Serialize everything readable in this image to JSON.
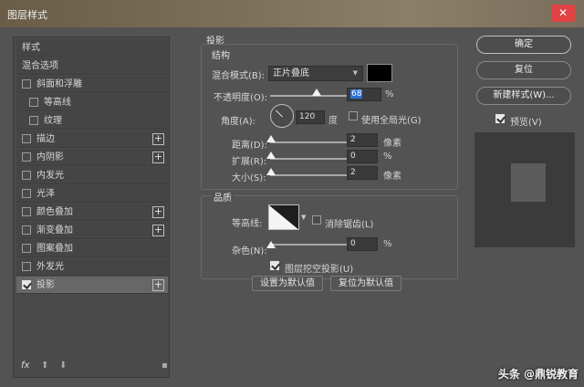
{
  "window": {
    "title": "图层样式",
    "close_icon": "close-icon"
  },
  "sidebar": {
    "items": [
      {
        "label": "样式",
        "checkbox": false,
        "checked": false,
        "plus": false,
        "indent": 0
      },
      {
        "label": "混合选项",
        "checkbox": false,
        "checked": false,
        "plus": false,
        "indent": 0
      },
      {
        "label": "斜面和浮雕",
        "checkbox": true,
        "checked": false,
        "plus": false,
        "indent": 0
      },
      {
        "label": "等高线",
        "checkbox": true,
        "checked": false,
        "plus": false,
        "indent": 1
      },
      {
        "label": "纹理",
        "checkbox": true,
        "checked": false,
        "plus": false,
        "indent": 1
      },
      {
        "label": "描边",
        "checkbox": true,
        "checked": false,
        "plus": true,
        "indent": 0
      },
      {
        "label": "内阴影",
        "checkbox": true,
        "checked": false,
        "plus": true,
        "indent": 0
      },
      {
        "label": "内发光",
        "checkbox": true,
        "checked": false,
        "plus": false,
        "indent": 0
      },
      {
        "label": "光泽",
        "checkbox": true,
        "checked": false,
        "plus": false,
        "indent": 0
      },
      {
        "label": "颜色叠加",
        "checkbox": true,
        "checked": false,
        "plus": true,
        "indent": 0
      },
      {
        "label": "渐变叠加",
        "checkbox": true,
        "checked": false,
        "plus": true,
        "indent": 0
      },
      {
        "label": "图案叠加",
        "checkbox": true,
        "checked": false,
        "plus": false,
        "indent": 0
      },
      {
        "label": "外发光",
        "checkbox": true,
        "checked": false,
        "plus": false,
        "indent": 0
      },
      {
        "label": "投影",
        "checkbox": true,
        "checked": true,
        "plus": true,
        "indent": 0,
        "selected": true
      }
    ],
    "bottom": {
      "fx": "fx",
      "up": "⬆",
      "down": "⬇",
      "trash": "🗑"
    }
  },
  "shadow": {
    "section_title": "投影",
    "structure": {
      "title": "结构",
      "blend_mode_label": "混合模式(B):",
      "blend_mode_value": "正片叠底",
      "blend_color": "#000000",
      "opacity_label": "不透明度(O):",
      "opacity_value": "68",
      "opacity_unit": "%",
      "angle_label": "角度(A):",
      "angle_value": "120",
      "angle_unit": "度",
      "global_light_label": "使用全局光(G)",
      "global_light_checked": false,
      "distance_label": "距离(D):",
      "distance_value": "2",
      "distance_unit": "像素",
      "spread_label": "扩展(R):",
      "spread_value": "0",
      "spread_unit": "%",
      "size_label": "大小(S):",
      "size_value": "2",
      "size_unit": "像素"
    },
    "quality": {
      "title": "品质",
      "contour_label": "等高线:",
      "antialias_label": "消除锯齿(L)",
      "antialias_checked": false,
      "noise_label": "杂色(N):",
      "noise_value": "0",
      "noise_unit": "%"
    },
    "knockout_label": "图层挖空投影(U)",
    "knockout_checked": true,
    "make_default": "设置为默认值",
    "reset_default": "复位为默认值"
  },
  "actions": {
    "ok": "确定",
    "reset": "复位",
    "new_style": "新建样式(W)...",
    "preview_label": "预览(V)",
    "preview_checked": true
  },
  "watermark": "头条 @鼎锐教育"
}
